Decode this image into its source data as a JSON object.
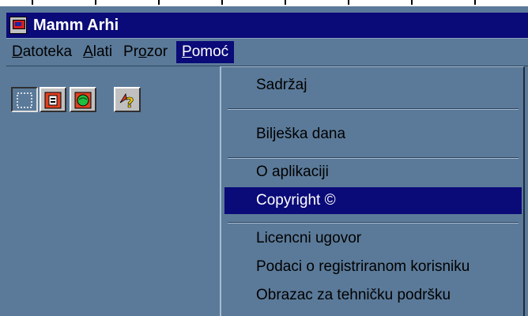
{
  "window": {
    "title": "Mamm Arhi"
  },
  "menubar": {
    "items": [
      {
        "label": "Datoteka",
        "underline": "D",
        "rest": "atoteka"
      },
      {
        "label": "Alati",
        "underline": "A",
        "rest": "lati"
      },
      {
        "label": "Prozor",
        "pre": "Pr",
        "underline": "o",
        "rest": "zor"
      },
      {
        "label": "Pomoć",
        "underline": "P",
        "rest": "omoć"
      }
    ]
  },
  "toolbar": {
    "buttons": [
      {
        "name": "select-tool",
        "icon": "dotted-square-icon",
        "pressed": true
      },
      {
        "name": "document-tool",
        "icon": "document-icon",
        "pressed": false
      },
      {
        "name": "globe-tool",
        "icon": "globe-icon",
        "pressed": false
      },
      {
        "name": "help-tool",
        "icon": "help-arrow-icon",
        "pressed": false
      }
    ]
  },
  "help_menu": {
    "items": [
      {
        "label": "Sadržaj"
      },
      {
        "label": "Bilješka dana"
      },
      {
        "label": "O aplikaciji"
      },
      {
        "label": "Copyright ©",
        "highlighted": true
      },
      {
        "label": "Licencni ugovor"
      },
      {
        "label": "Podaci o registriranom korisniku"
      },
      {
        "label": "Obrazac za tehničku podršku"
      }
    ]
  }
}
